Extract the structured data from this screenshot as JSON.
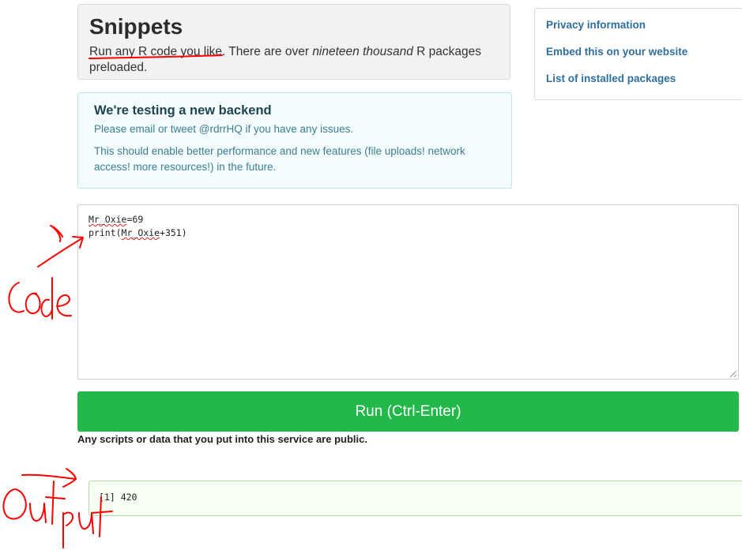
{
  "hero": {
    "title": "Snippets",
    "desc_part1": "Run any R code you like. There are over ",
    "desc_em": "nineteen thousand",
    "desc_part2": " R packages preloaded."
  },
  "sidebar": {
    "links": [
      "Privacy information",
      "Embed this on your website",
      "List of installed packages"
    ]
  },
  "alert": {
    "title": "We're testing a new backend",
    "line1": "Please email or tweet @rdrrHQ if you have any issues.",
    "line2": "This should enable better performance and new features (file uploads! network access! more resources!) in the future."
  },
  "editor": {
    "line1_var": "Mr_Oxie",
    "line1_rest": "=69",
    "line2_pre": "print(",
    "line2_var": "Mr_Oxie",
    "line2_rest": "+351)"
  },
  "run_button": {
    "label": "Run (Ctrl-Enter)"
  },
  "notice": "Any scripts or data that you put into this service are public.",
  "output": "[1] 420",
  "colors": {
    "run_button": "#22b94a",
    "annotation": "#ff0000",
    "link": "#2f6f9f"
  }
}
